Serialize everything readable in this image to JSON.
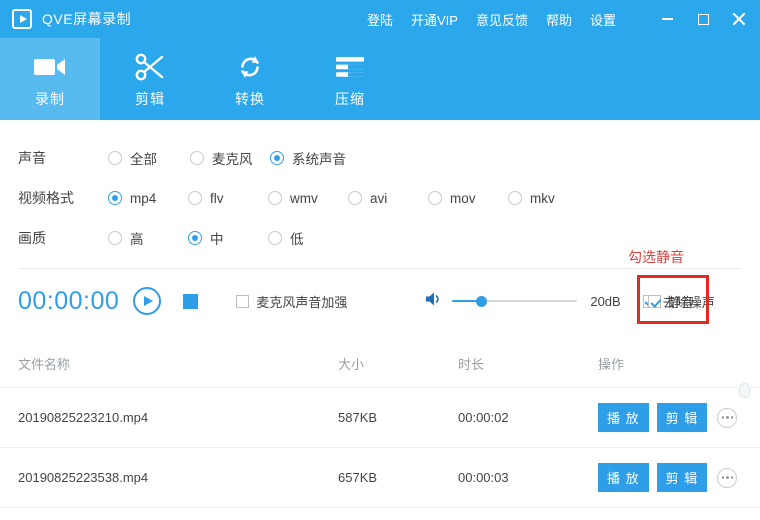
{
  "window": {
    "brand_logo_icon": "play-logo-icon",
    "title": "QVE屏幕录制",
    "menu": [
      "登陆",
      "开通VIP",
      "意见反馈",
      "帮助",
      "设置"
    ],
    "controls": {
      "minimize": "minimize-icon",
      "maximize": "maximize-icon",
      "close": "close-icon"
    },
    "accent_color": "#2ba7ec",
    "accent_active_tab": "#57bbf0"
  },
  "tabs": [
    {
      "label": "录制",
      "icon": "video-camera-icon",
      "active": true
    },
    {
      "label": "剪辑",
      "icon": "scissors-icon",
      "active": false
    },
    {
      "label": "转换",
      "icon": "refresh-icon",
      "active": false
    },
    {
      "label": "压缩",
      "icon": "compress-lines-icon",
      "active": false
    }
  ],
  "options": {
    "sound": {
      "label": "声音",
      "items": [
        {
          "text": "全部",
          "selected": false
        },
        {
          "text": "麦克风",
          "selected": false
        },
        {
          "text": "系统声音",
          "selected": true
        }
      ]
    },
    "video_format": {
      "label": "视频格式",
      "items": [
        {
          "text": "mp4",
          "selected": true
        },
        {
          "text": "flv",
          "selected": false
        },
        {
          "text": "wmv",
          "selected": false
        },
        {
          "text": "avi",
          "selected": false
        },
        {
          "text": "mov",
          "selected": false
        },
        {
          "text": "mkv",
          "selected": false
        }
      ]
    },
    "quality": {
      "label": "画质",
      "items": [
        {
          "text": "高",
          "selected": false
        },
        {
          "text": "中",
          "selected": true
        },
        {
          "text": "低",
          "selected": false
        }
      ]
    }
  },
  "control_bar": {
    "timer": "00:00:00",
    "play_icon": "play-circle-icon",
    "stop_icon": "stop-square-icon",
    "mic_boost": {
      "label": "麦克风声音加强",
      "checked": false
    },
    "volume_icon": "speaker-icon",
    "volume_db": "20dB",
    "slider_percent": 22,
    "denoise": {
      "label": "去除噪声",
      "checked": true
    },
    "mute": {
      "label": "静音",
      "checked": true
    }
  },
  "annotation": {
    "text": "勾选静音",
    "color": "#e02b20"
  },
  "file_table": {
    "columns": [
      "文件名称",
      "大小",
      "时长",
      "操作"
    ],
    "rows": [
      {
        "name": "20190825223210.mp4",
        "size": "587KB",
        "duration": "00:00:02",
        "play": "播 放",
        "edit": "剪 辑",
        "more": "more-dots-icon"
      },
      {
        "name": "20190825223538.mp4",
        "size": "657KB",
        "duration": "00:00:03",
        "play": "播 放",
        "edit": "剪 辑",
        "more": "more-dots-icon"
      }
    ]
  }
}
